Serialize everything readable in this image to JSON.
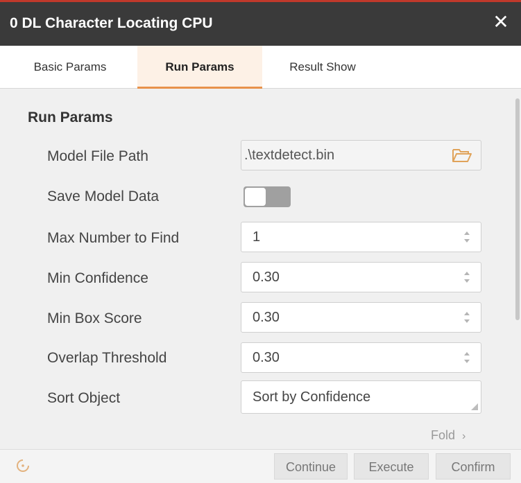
{
  "window": {
    "title": "0 DL Character Locating CPU",
    "close_icon": "close-icon"
  },
  "tabs": [
    {
      "label": "Basic Params",
      "active": false
    },
    {
      "label": "Run Params",
      "active": true
    },
    {
      "label": "Result Show",
      "active": false
    }
  ],
  "section": {
    "title": "Run Params"
  },
  "params": {
    "model_file_path": {
      "label": "Model File Path",
      "value": ".\\textdetect.bin",
      "icon": "folder-open-icon"
    },
    "save_model_data": {
      "label": "Save Model Data",
      "on": false
    },
    "max_number_to_find": {
      "label": "Max Number to Find",
      "value": "1"
    },
    "min_confidence": {
      "label": "Min Confidence",
      "value": "0.30"
    },
    "min_box_score": {
      "label": "Min Box Score",
      "value": "0.30"
    },
    "overlap_threshold": {
      "label": "Overlap Threshold",
      "value": "0.30"
    },
    "sort_object": {
      "label": "Sort Object",
      "value": "Sort by Confidence"
    }
  },
  "fold": {
    "label": "Fold",
    "icon": "chevron-right-icon"
  },
  "footer": {
    "icon": "loading-icon",
    "buttons": {
      "continue": "Continue",
      "execute": "Execute",
      "confirm": "Confirm"
    }
  },
  "colors": {
    "titlebar": "#3a3a3a",
    "accent": "#e8914a",
    "active_tab_bg": "#fdf1e6"
  }
}
